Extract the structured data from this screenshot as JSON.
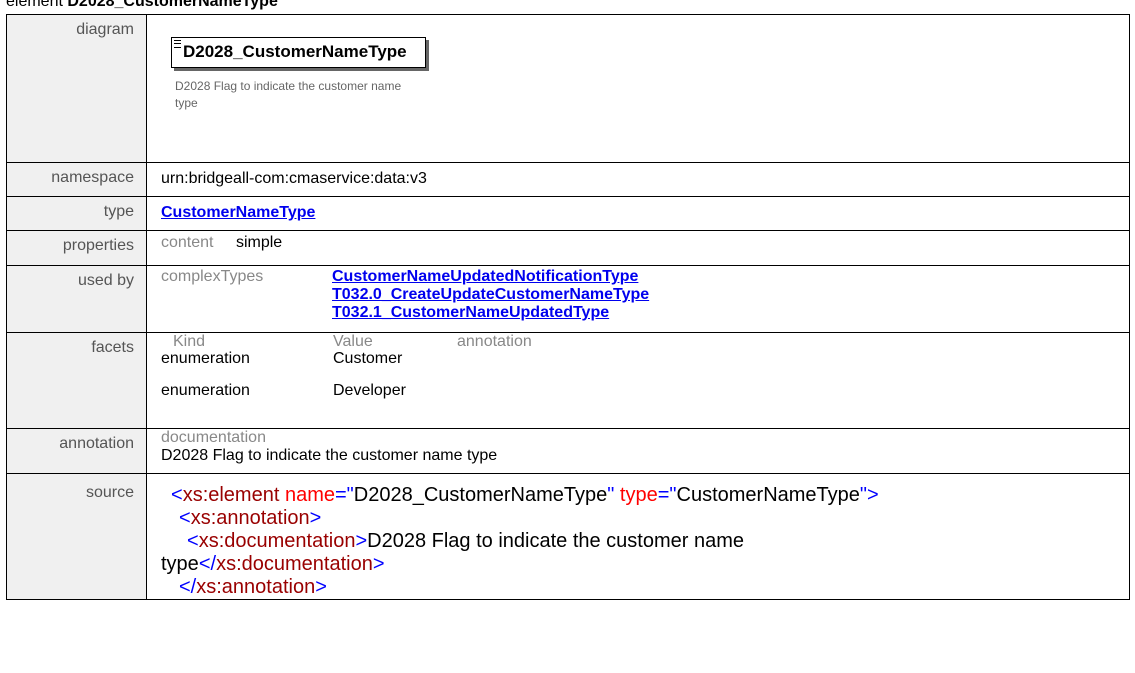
{
  "heading": {
    "prefix": "element",
    "name": "D2028_CustomerNameType"
  },
  "rows": {
    "diagram": {
      "label": "diagram",
      "box_title": "D2028_CustomerNameType",
      "doc_text": "D2028 Flag to indicate the customer name type"
    },
    "namespace": {
      "label": "namespace",
      "value": "urn:bridgeall-com:cmaservice:data:v3"
    },
    "type": {
      "label": "type",
      "value": "CustomerNameType"
    },
    "properties": {
      "label": "properties",
      "key": "content",
      "value": "simple"
    },
    "used_by": {
      "label": "used by",
      "category": "complexTypes",
      "links": [
        "CustomerNameUpdatedNotificationType",
        "T032.0_CreateUpdateCustomerNameType",
        "T032.1_CustomerNameUpdatedType"
      ]
    },
    "facets": {
      "label": "facets",
      "headers": [
        "Kind",
        "Value",
        "annotation"
      ],
      "items": [
        {
          "kind": "enumeration",
          "value": "Customer"
        },
        {
          "kind": "enumeration",
          "value": "Developer"
        }
      ]
    },
    "annotation": {
      "label": "annotation",
      "key": "documentation",
      "value": "D2028 Flag to indicate the customer name type"
    },
    "source": {
      "label": "source",
      "l1": {
        "open": "<",
        "tag": "xs:element",
        "a1": " name",
        "eq1": "=\"",
        "v1": "D2028_CustomerNameType",
        "q1": "\"",
        "a2": " type",
        "eq2": "=\"",
        "v2": "CustomerNameType",
        "close": "\">"
      },
      "l2": {
        "open": "<",
        "tag": "xs:annotation",
        "close": ">"
      },
      "l3": {
        "open": "<",
        "tag": "xs:documentation",
        "close": ">",
        "text": "D2028 Flag to indicate the customer name"
      },
      "l4": {
        "text": "type",
        "open": "</",
        "tag": "xs:documentation",
        "close": ">"
      },
      "l5": {
        "open": "</",
        "tag": "xs:annotation",
        "close": ">"
      }
    }
  }
}
